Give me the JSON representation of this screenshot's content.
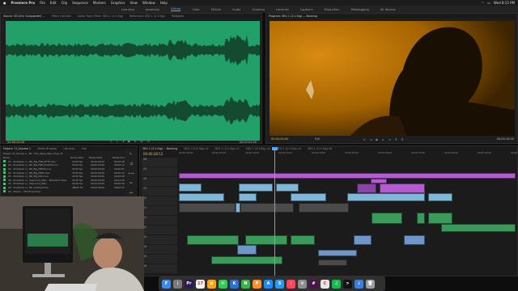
{
  "menubar": {
    "app": "Premiere Pro",
    "items": [
      "File",
      "Edit",
      "Clip",
      "Sequence",
      "Markers",
      "Graphics",
      "View",
      "Window",
      "Help"
    ],
    "status_time": "Wed 8:15 PM"
  },
  "workspaces": {
    "items": [
      "Learning",
      "Assembly",
      "Editing",
      "Color",
      "Effects",
      "Audio",
      "Graphics",
      "Libraries",
      "Captions",
      "Production",
      "Metalogging",
      "AE Review"
    ],
    "active_index": 2
  },
  "source_panel": {
    "tabs": [
      "Source: B3 (Dry Gunpowder) ...",
      "Effect Controls",
      "Audio Track Mixer: SEQ 1 (2:1:Sig)",
      "Reference: SEQ 1 (2:1:Sig)",
      "Metadata"
    ],
    "timecode_left": "00:00:00:00",
    "timecode_right": "00:00:01:00",
    "waveform_color": "#21a06a"
  },
  "program_panel": {
    "tabs": [
      "Program: SEQ 1 (2:1:Sig) — Banking"
    ],
    "timecode_left": "00:00:00:00",
    "timecode_right": "00:00:10:00",
    "scale": "Full",
    "frame_color": "#a86a00"
  },
  "project_panel": {
    "tabs": [
      "Project: Ct_Volume 1",
      "Media Browser",
      "Libraries",
      "Info"
    ],
    "title": "Project: Ct_Volume 1 - BS - Trac_Maya_Main_Final_V5",
    "columns": [
      "Name",
      "Frame Rate",
      "Media Start",
      "Media End",
      "Media Duration"
    ],
    "rows": [
      {
        "name": "01 - Shutdown in_ ND_Big_FRB_PH7R.mov",
        "rate": "30.00 fps",
        "start": "00:00:00:00",
        "end": "00:00:09:07"
      },
      {
        "name": "02 - Shutdown in_ ND_Big_FRB_Phil2FR.mov",
        "rate": "30.00 fps",
        "start": "00:00:00:00",
        "end": "00:00:11:14"
      },
      {
        "name": "03 - Shutdown in_ ND_Big_NWCN.mov",
        "rate": "30.00 fps",
        "start": "00:00:00:00",
        "end": "00:00:07:22"
      },
      {
        "name": "04 - Shutdown in_ ND_Big_FRB2.mov",
        "rate": "30.00 fps",
        "start": "00:00:00:00",
        "end": "00:00:12:03"
      },
      {
        "name": "05 - Shutdown in_ ND_Big_MIX.mov",
        "rate": "30.00 fps",
        "start": "00:00:00:00",
        "end": "00:00:08:18"
      },
      {
        "name": "06 - Shutdown in_ Sequence_Main - Midmatch View",
        "rate": "24.00 fps",
        "start": "00:00:00:00",
        "end": "00:01:05:10"
      },
      {
        "name": "07 - Shutdown in_ Sequence_Main",
        "rate": "24.00 fps",
        "start": "00:00:00:00",
        "end": "00:00:40:02"
      },
      {
        "name": "08 - Shutdown in_ ND_Ambient.wav",
        "rate": "48000 Hz",
        "start": "00:00:00:00",
        "end": "00:00:55:00"
      },
      {
        "name": "09 - Tracks ~ SFX Production",
        "rate": "",
        "start": "",
        "end": ""
      }
    ]
  },
  "timeline": {
    "tabs": [
      "SEQ 1 (2:1:Sig) ~ Banking",
      "SEQ 1 (2:1:Sig) v2",
      "SEQ 1 (2:1:Sig) v3",
      "SEQ 1 (2:1:Sig) v4",
      "SEQ 1 (2:1:Sig) v5",
      "SEQ 1 (2:1:Sig) v6"
    ],
    "timecode": "00:00:28:12",
    "ruler": [
      "00:00:00:00",
      "00:00:05:00",
      "00:00:10:00",
      "00:00:15:00",
      "00:00:20:00",
      "00:00:25:00",
      "00:00:30:00",
      "00:00:35:00",
      "00:00:40:00",
      "00:00:45:00",
      "00:00:50:00"
    ],
    "tracks": [
      "V6",
      "V5",
      "V4",
      "V3",
      "V2",
      "V1",
      "A1",
      "A2",
      "A3",
      "A4",
      "A5",
      "A6"
    ]
  },
  "dock": {
    "apps": [
      {
        "name": "finder",
        "color": "#3c8ce6",
        "label": "F"
      },
      {
        "name": "launchpad",
        "color": "#7b7b7b",
        "label": "⋮"
      },
      {
        "name": "premiere-pro",
        "color": "#2a1b4f",
        "label": "Pr"
      },
      {
        "name": "calendar",
        "color": "#f2f2f2",
        "label": "17"
      },
      {
        "name": "photos",
        "color": "#f7a520",
        "label": "✿"
      },
      {
        "name": "messages",
        "color": "#35c759",
        "label": "✉"
      },
      {
        "name": "keynote",
        "color": "#2a6fd6",
        "label": "K"
      },
      {
        "name": "numbers",
        "color": "#3bb34a",
        "label": "N"
      },
      {
        "name": "pages",
        "color": "#f5922b",
        "label": "P"
      },
      {
        "name": "app-store",
        "color": "#1d8cf5",
        "label": "A"
      },
      {
        "name": "safari",
        "color": "#2b9af3",
        "label": "S"
      },
      {
        "name": "music",
        "color": "#f2465b",
        "label": "♪"
      },
      {
        "name": "settings",
        "color": "#8e8e8e",
        "label": "⚙"
      },
      {
        "name": "slack",
        "color": "#4a154b",
        "label": "#"
      },
      {
        "name": "chrome",
        "color": "#e6e6e6",
        "label": "C"
      },
      {
        "name": "spotify",
        "color": "#1db954",
        "label": "♫"
      },
      {
        "name": "terminal",
        "color": "#111111",
        "label": ">"
      },
      {
        "name": "downloads",
        "color": "#3f7fd9",
        "label": "↓"
      },
      {
        "name": "trash",
        "color": "#9e9e9e",
        "label": "🗑"
      }
    ]
  }
}
